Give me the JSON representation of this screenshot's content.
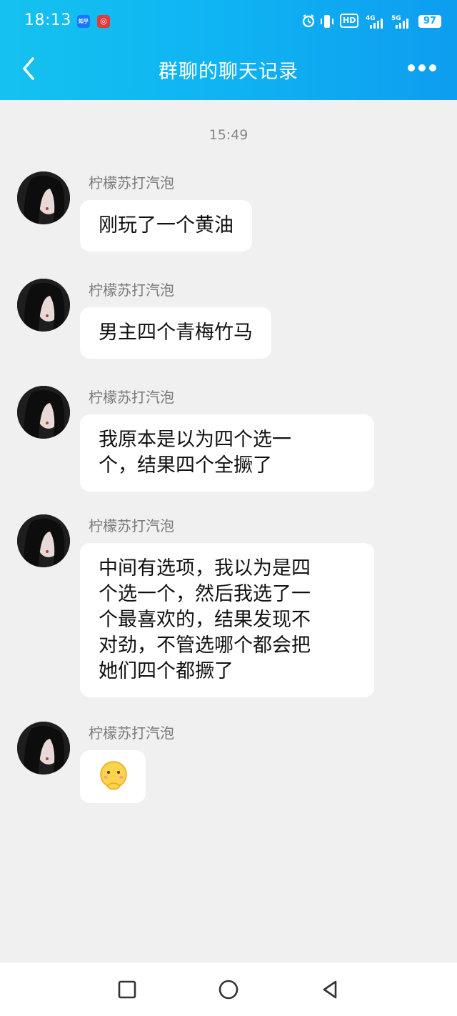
{
  "status_bar": {
    "time": "18:13",
    "apps": [
      "知乎",
      "网易云"
    ],
    "hd_label": "HD",
    "net1": "4G",
    "net2": "5G",
    "battery": "97",
    "icons": [
      "alarm-icon",
      "vibrate-icon",
      "signal-4g-icon",
      "signal-5g-icon",
      "battery-icon"
    ]
  },
  "header": {
    "title": "群聊的聊天记录",
    "back_icon": "chevron-left-icon",
    "more_icon": "more-dots-icon"
  },
  "chat": {
    "timestamp": "15:49",
    "messages": [
      {
        "sender": "柠檬苏打汽泡",
        "text": "刚玩了一个黄油"
      },
      {
        "sender": "柠檬苏打汽泡",
        "text": "男主四个青梅竹马"
      },
      {
        "sender": "柠檬苏打汽泡",
        "lines": [
          "我原本是以为四个选一",
          "个，结果四个全撅了"
        ]
      },
      {
        "sender": "柠檬苏打汽泡",
        "lines": [
          "中间有选项，我以为是四",
          "个选一个，然后我选了一",
          "个最喜欢的，结果发现不",
          "对劲，不管选哪个都会把",
          "她们四个都撅了"
        ]
      },
      {
        "sender": "柠檬苏打汽泡",
        "emoji": "shy-face-emoji"
      }
    ]
  },
  "system_nav": {
    "icons": [
      "recent-apps-icon",
      "home-icon",
      "back-triangle-icon"
    ]
  },
  "colors": {
    "header_start": "#14c2f0",
    "header_end": "#0e9df0",
    "background": "#f0f0f0",
    "bubble": "#ffffff"
  }
}
